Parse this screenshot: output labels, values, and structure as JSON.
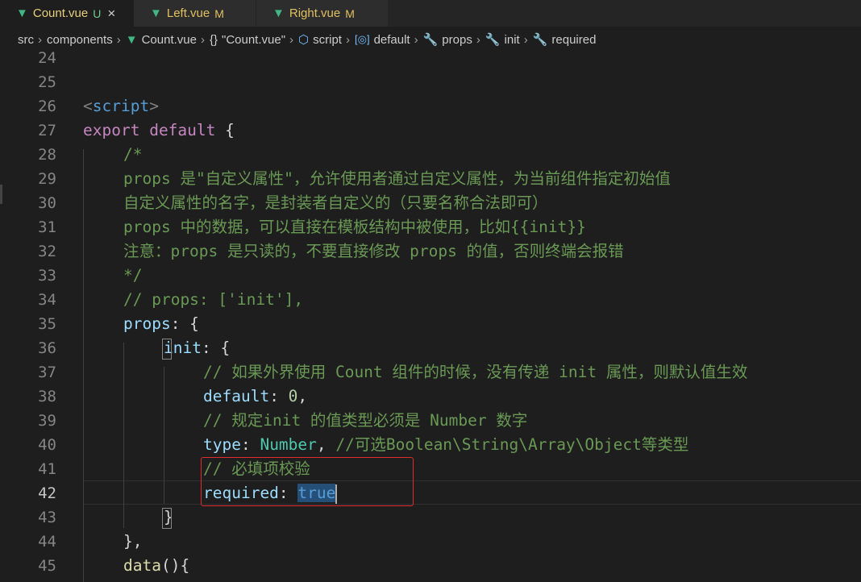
{
  "tabs": [
    {
      "icon": "vue-icon",
      "name": "Count.vue",
      "badge": "U",
      "close": "×"
    },
    {
      "icon": "vue-icon",
      "name": "Left.vue",
      "badge": "M"
    },
    {
      "icon": "vue-icon",
      "name": "Right.vue",
      "badge": "M"
    }
  ],
  "breadcrumb": [
    "src",
    "components",
    "Count.vue",
    "\"Count.vue\"",
    "script",
    "default",
    "props",
    "init",
    "required"
  ],
  "code": {
    "ln": [
      "24",
      "25",
      "26",
      "27",
      "28",
      "29",
      "30",
      "31",
      "32",
      "33",
      "34",
      "35",
      "36",
      "37",
      "38",
      "39",
      "40",
      "41",
      "42",
      "43",
      "44",
      "45"
    ],
    "l26": {
      "lt": "<",
      "tag": "script",
      "gt": ">"
    },
    "l27": {
      "kw1": "export",
      "kw2": "default",
      "rest": " {"
    },
    "l28": "/*",
    "l29": "props 是\"自定义属性\"，允许使用者通过自定义属性，为当前组件指定初始值",
    "l30": "自定义属性的名字，是封装者自定义的（只要名称合法即可）",
    "l31": "props 中的数据，可以直接在模板结构中被使用，比如{{init}}",
    "l32": "注意：props 是只读的，不要直接修改 props 的值，否则终端会报错",
    "l33": "*/",
    "l34": "// props: ['init'],",
    "l35": {
      "key": "props",
      "rest": ": {"
    },
    "l36": {
      "key": "init",
      "colon": ": ",
      "brace": "{"
    },
    "l37": "// 如果外界使用 Count 组件的时候，没有传递 init 属性，则默认值生效",
    "l38": {
      "key": "default",
      "colon": ": ",
      "val": "0",
      "end": ","
    },
    "l39": "// 规定init 的值类型必须是 Number 数字",
    "l40": {
      "key": "type",
      "colon": ": ",
      "val": "Number",
      "end": ", ",
      "comment": "//可选Boolean\\String\\Array\\Object等类型"
    },
    "l41": "// 必填项校验",
    "l42": {
      "key": "required",
      "colon": ": ",
      "val": "true"
    },
    "l43": "}",
    "l44": "},",
    "l45": {
      "fn": "data",
      "rest": "(){"
    }
  }
}
